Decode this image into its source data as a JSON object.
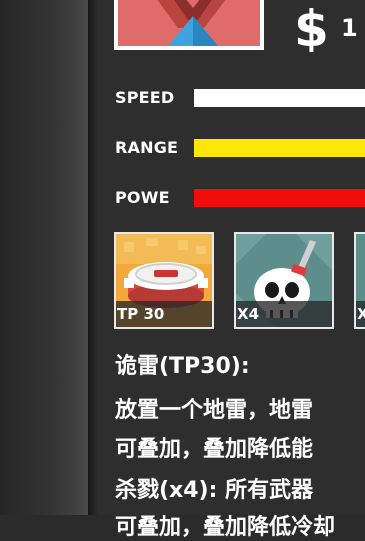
{
  "currency_value": "1",
  "stats": [
    {
      "label": "SPEED",
      "color": "#ffffff"
    },
    {
      "label": "RANGE",
      "color": "#ffe60a"
    },
    {
      "label": "POWE",
      "color": "#f20d0d"
    }
  ],
  "perks": [
    {
      "label": "TP 30",
      "icon": "landmine-icon"
    },
    {
      "label": "X4",
      "icon": "skull-dagger-icon"
    },
    {
      "label": "X",
      "icon": "partial-perk-icon"
    }
  ],
  "description": [
    "诡雷(TP30):",
    "放置一个地雷，地雷",
    "可叠加，叠加降低能",
    "杀戮(x4): 所有武器",
    "可叠加，叠加降低冷却"
  ],
  "colors": {
    "panel": "#2e2e2e",
    "tower_red": "#e06b6b",
    "tower_blue": "#3ea3e0"
  }
}
